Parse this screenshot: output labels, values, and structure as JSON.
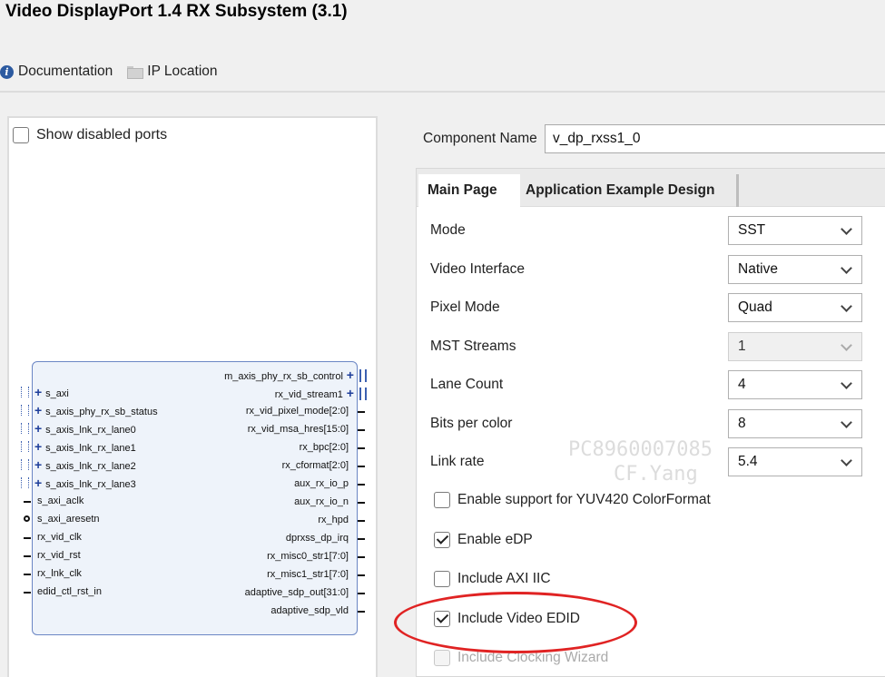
{
  "window": {
    "title": "Video DisplayPort 1.4 RX Subsystem (3.1)"
  },
  "toolbar": {
    "documentation": {
      "label": "Documentation",
      "icon": "info-icon"
    },
    "ip_location": {
      "label": "IP Location",
      "icon": "folder-icon"
    }
  },
  "left_panel": {
    "show_disabled_ports": {
      "label": "Show disabled ports",
      "checked": false
    },
    "block": {
      "left_ports": [
        {
          "name": "s_axi",
          "kind": "bus"
        },
        {
          "name": "s_axis_phy_rx_sb_status",
          "kind": "bus"
        },
        {
          "name": "s_axis_lnk_rx_lane0",
          "kind": "bus"
        },
        {
          "name": "s_axis_lnk_rx_lane1",
          "kind": "bus"
        },
        {
          "name": "s_axis_lnk_rx_lane2",
          "kind": "bus"
        },
        {
          "name": "s_axis_lnk_rx_lane3",
          "kind": "bus"
        },
        {
          "name": "s_axi_aclk",
          "kind": "wire"
        },
        {
          "name": "s_axi_aresetn",
          "kind": "reset"
        },
        {
          "name": "rx_vid_clk",
          "kind": "wire"
        },
        {
          "name": "rx_vid_rst",
          "kind": "wire"
        },
        {
          "name": "rx_lnk_clk",
          "kind": "wire"
        },
        {
          "name": "edid_ctl_rst_in",
          "kind": "wire"
        }
      ],
      "right_ports": [
        {
          "name": "m_axis_phy_rx_sb_control",
          "kind": "bus"
        },
        {
          "name": "rx_vid_stream1",
          "kind": "bus"
        },
        {
          "name": "rx_vid_pixel_mode[2:0]",
          "kind": "wire"
        },
        {
          "name": "rx_vid_msa_hres[15:0]",
          "kind": "wire"
        },
        {
          "name": "rx_bpc[2:0]",
          "kind": "wire"
        },
        {
          "name": "rx_cformat[2:0]",
          "kind": "wire"
        },
        {
          "name": "aux_rx_io_p",
          "kind": "wire"
        },
        {
          "name": "aux_rx_io_n",
          "kind": "wire"
        },
        {
          "name": "rx_hpd",
          "kind": "wire"
        },
        {
          "name": "dprxss_dp_irq",
          "kind": "wire"
        },
        {
          "name": "rx_misc0_str1[7:0]",
          "kind": "wire"
        },
        {
          "name": "rx_misc1_str1[7:0]",
          "kind": "wire"
        },
        {
          "name": "adaptive_sdp_out[31:0]",
          "kind": "wire"
        },
        {
          "name": "adaptive_sdp_vld",
          "kind": "wire"
        }
      ]
    }
  },
  "component": {
    "label": "Component Name",
    "value": "v_dp_rxss1_0"
  },
  "tabs": [
    {
      "label": "Main Page",
      "active": true
    },
    {
      "label": "Application Example Design",
      "active": false
    }
  ],
  "main_page": {
    "fields": [
      {
        "label": "Mode",
        "value": "SST",
        "disabled": false
      },
      {
        "label": "Video Interface",
        "value": "Native",
        "disabled": false
      },
      {
        "label": "Pixel Mode",
        "value": "Quad",
        "disabled": false
      },
      {
        "label": "MST Streams",
        "value": "1",
        "disabled": true
      },
      {
        "label": "Lane Count",
        "value": "4",
        "disabled": false
      },
      {
        "label": "Bits per color",
        "value": "8",
        "disabled": false
      },
      {
        "label": "Link rate",
        "value": "5.4",
        "disabled": false
      }
    ],
    "checkboxes": [
      {
        "label": "Enable support for YUV420 ColorFormat",
        "checked": false,
        "disabled": false
      },
      {
        "label": "Enable eDP",
        "checked": true,
        "disabled": false
      },
      {
        "label": "Include AXI IIC",
        "checked": false,
        "disabled": false
      },
      {
        "label": "Include Video EDID",
        "checked": true,
        "disabled": false
      },
      {
        "label": "Include Clocking Wizard",
        "checked": false,
        "disabled": true
      }
    ]
  },
  "watermark": {
    "line1": "PC8960007085",
    "line2": "CF.Yang"
  },
  "annotation": {
    "color": "#e02323"
  }
}
